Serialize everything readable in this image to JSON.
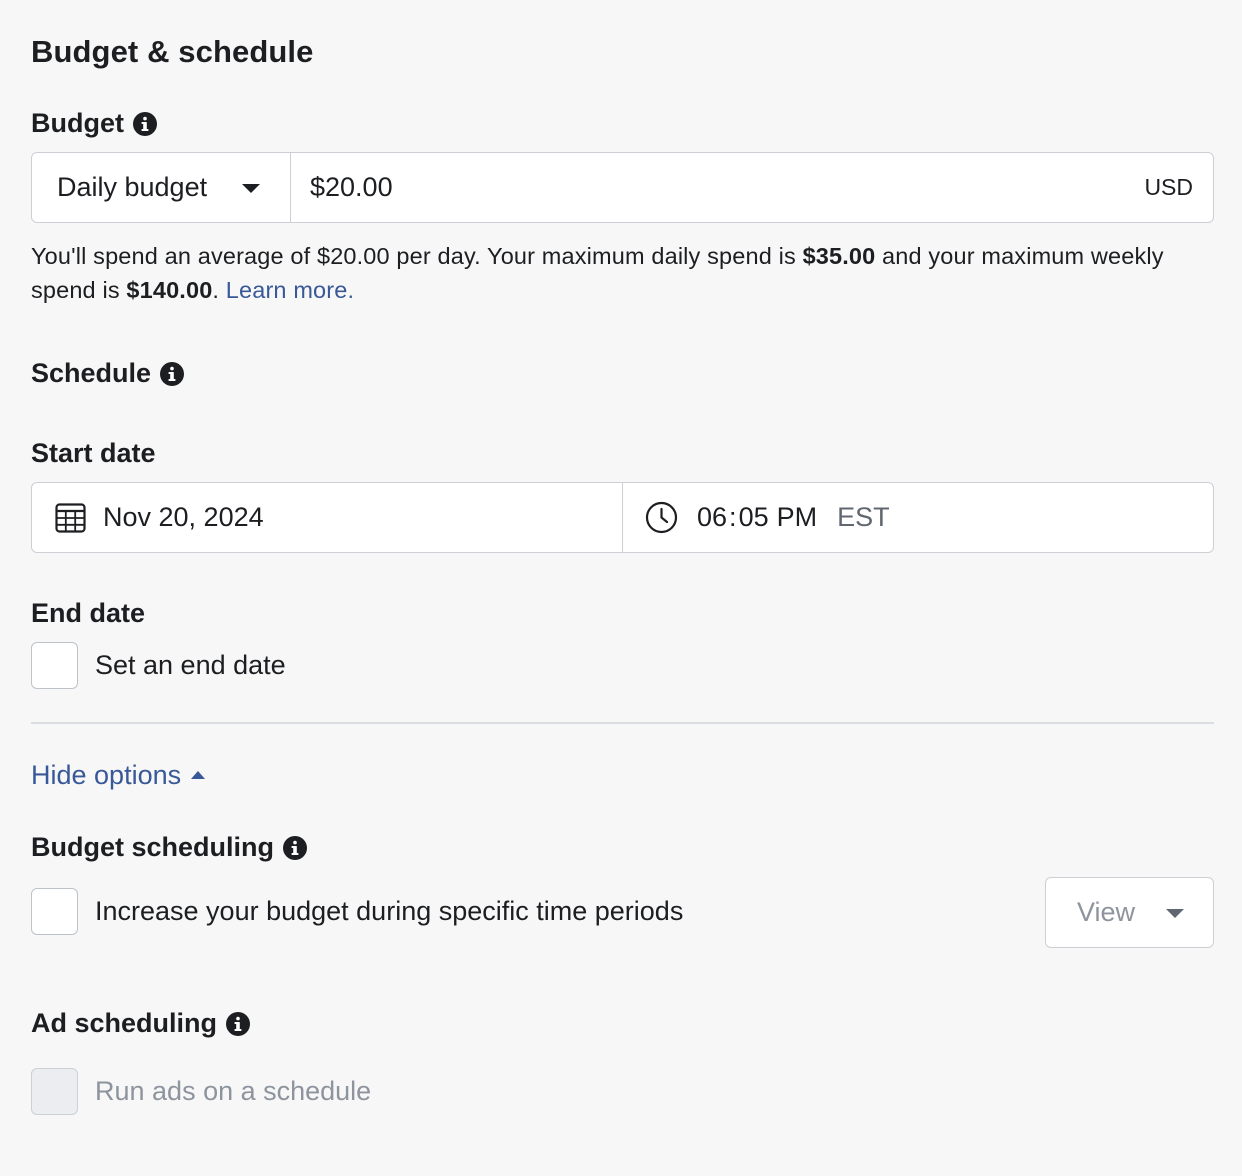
{
  "section_title": "Budget & schedule",
  "budget": {
    "label": "Budget",
    "type_selected": "Daily budget",
    "amount_value": "$20.00",
    "currency": "USD",
    "help_prefix": "You'll spend an average of $20.00 per day. Your maximum daily spend is",
    "max_daily": "$35.00",
    "help_middle": "and your maximum weekly spend is",
    "max_weekly": "$140.00",
    "help_suffix": ".",
    "learn_more": "Learn more."
  },
  "schedule": {
    "label": "Schedule",
    "start_date_label": "Start date",
    "start_date_value": "Nov 20, 2024",
    "start_hour": "06",
    "time_separator": ":",
    "start_minute": "05",
    "start_ampm": "PM",
    "timezone": "EST",
    "end_date_label": "End date",
    "end_date_checkbox_label": "Set an end date"
  },
  "hide_options_label": "Hide options",
  "budget_scheduling": {
    "label": "Budget scheduling",
    "checkbox_label": "Increase your budget during specific time periods",
    "view_button": "View"
  },
  "ad_scheduling": {
    "label": "Ad scheduling",
    "checkbox_label": "Run ads on a schedule"
  },
  "icons": {
    "info": "info-icon",
    "calendar": "calendar-icon",
    "clock": "clock-icon"
  },
  "colors": {
    "link": "#385898",
    "text": "#1c1e21",
    "muted": "#8d949e",
    "border": "#ccd0d5",
    "background": "#f7f7f7"
  }
}
